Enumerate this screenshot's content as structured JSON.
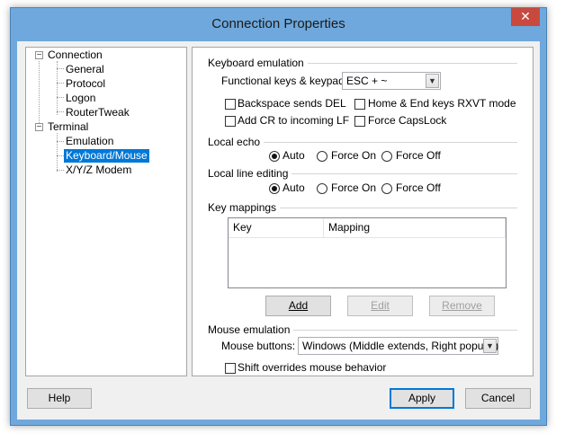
{
  "window": {
    "title": "Connection Properties",
    "close_glyph": "✕"
  },
  "tree": {
    "items": [
      {
        "label": "Connection",
        "expander": "−"
      },
      {
        "label": "General"
      },
      {
        "label": "Protocol"
      },
      {
        "label": "Logon"
      },
      {
        "label": "RouterTweak"
      },
      {
        "label": "Terminal",
        "expander": "−"
      },
      {
        "label": "Emulation"
      },
      {
        "label": "Keyboard/Mouse",
        "selected": true
      },
      {
        "label": "X/Y/Z Modem"
      }
    ]
  },
  "keyboard_emulation": {
    "group_label": "Keyboard emulation",
    "functional_keys_label": "Functional keys & keypad:",
    "functional_keys_value": "ESC + ~",
    "backspace_del": {
      "label": "Backspace sends DEL",
      "checked": false
    },
    "home_end_rxvt": {
      "label": "Home & End keys RXVT mode",
      "checked": false
    },
    "add_cr_lf": {
      "label": "Add CR to incoming LF",
      "checked": false
    },
    "force_capslock": {
      "label": "Force CapsLock",
      "checked": false
    }
  },
  "local_echo": {
    "group_label": "Local echo",
    "options": [
      "Auto",
      "Force On",
      "Force Off"
    ],
    "selected": "Auto"
  },
  "local_line_editing": {
    "group_label": "Local line editing",
    "options": [
      "Auto",
      "Force On",
      "Force Off"
    ],
    "selected": "Auto"
  },
  "key_mappings": {
    "group_label": "Key mappings",
    "columns": [
      "Key",
      "Mapping"
    ],
    "rows": [],
    "add_label": "Add",
    "edit_label": "Edit",
    "remove_label": "Remove"
  },
  "mouse_emulation": {
    "group_label": "Mouse emulation",
    "mouse_buttons_label": "Mouse buttons:",
    "mouse_buttons_value": "Windows (Middle extends, Right popups)",
    "shift_overrides": {
      "label": "Shift overrides mouse behavior",
      "checked": false
    }
  },
  "footer": {
    "help_label": "Help",
    "apply_label": "Apply",
    "cancel_label": "Cancel"
  },
  "icons": {
    "dropdown_arrow": "chevron-down-icon",
    "tree_expander": "minus-box-icon"
  }
}
